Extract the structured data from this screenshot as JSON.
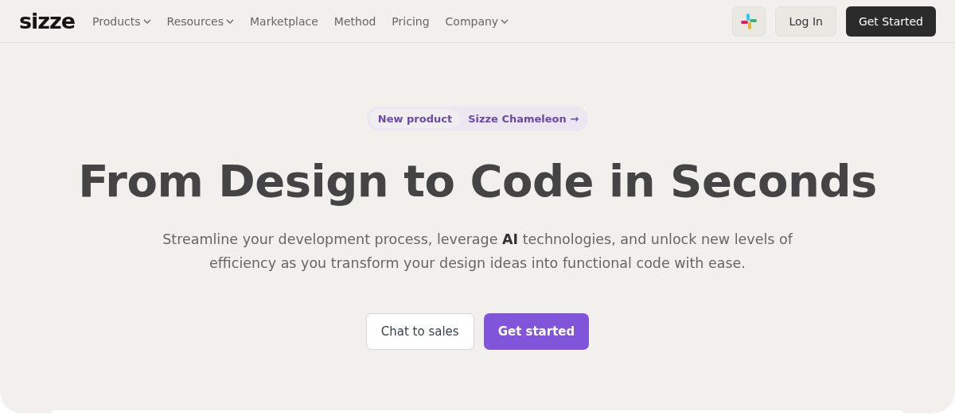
{
  "logo": "sizze",
  "nav": [
    {
      "label": "Products",
      "dropdown": true
    },
    {
      "label": "Resources",
      "dropdown": true
    },
    {
      "label": "Marketplace",
      "dropdown": false
    },
    {
      "label": "Method",
      "dropdown": false
    },
    {
      "label": "Pricing",
      "dropdown": false
    },
    {
      "label": "Company",
      "dropdown": true
    }
  ],
  "actions": {
    "login": "Log In",
    "get_started": "Get Started"
  },
  "announcement": {
    "badge": "New product",
    "link": "Sizze Chameleon",
    "arrow": "→"
  },
  "hero": {
    "title": "From Design to Code in Seconds",
    "subtitle": "Streamline your development process, leverage **AI** technologies, and unlock new levels of efficiency as you transform your design ideas into functional code with ease."
  },
  "buttons": {
    "secondary": "Chat to sales",
    "primary": "Get started"
  }
}
